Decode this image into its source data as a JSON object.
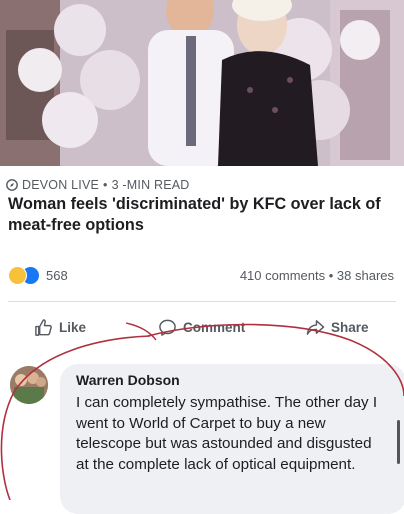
{
  "post": {
    "source_name": "DEVON LIVE",
    "read_time": "3 -MIN READ",
    "headline": "Woman feels 'discriminated' by KFC over lack of meat-free options"
  },
  "engagement": {
    "reaction_count": "568",
    "comments_text": "410 comments",
    "separator": "•",
    "shares_text": "38 shares",
    "reactions": [
      "haha",
      "like"
    ],
    "colors": {
      "haha": "#f7c23a",
      "like": "#1877f2"
    }
  },
  "actions": {
    "like_label": "Like",
    "comment_label": "Comment",
    "share_label": "Share"
  },
  "comment": {
    "author": "Warren Dobson",
    "text": "I can completely sympathise. The other day I went to World of Carpet to buy a new telescope but was astounded and disgusted at the complete lack of optical equipment."
  },
  "annotation": {
    "color": "#b03040"
  }
}
